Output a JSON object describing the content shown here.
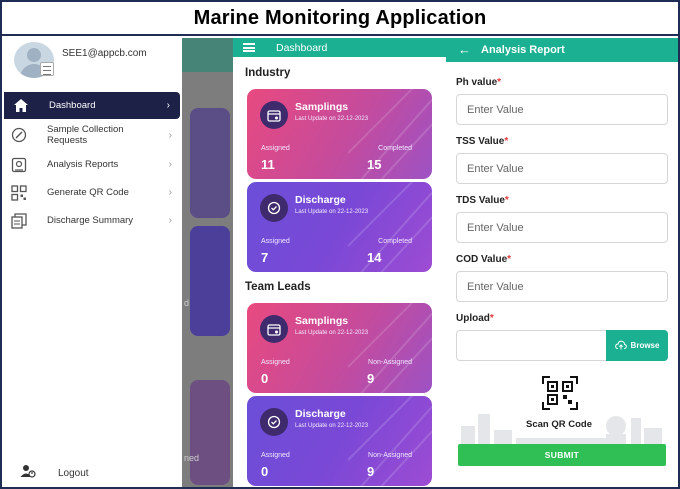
{
  "page_title": "Marine Monitoring Application",
  "drawer": {
    "email": "SEE1@appcb.com",
    "menu": [
      {
        "label": "Dashboard",
        "icon": "home-icon"
      },
      {
        "label": "Sample Collection Requests",
        "icon": "clipboard-link-icon"
      },
      {
        "label": "Analysis Reports",
        "icon": "report-icon"
      },
      {
        "label": "Generate QR Code",
        "icon": "qr-grid-icon"
      },
      {
        "label": "Discharge Summary",
        "icon": "documents-icon"
      }
    ],
    "logout_label": "Logout",
    "background_fragments": {
      "bottom_text": "ned",
      "mid_text": "d"
    }
  },
  "dashboard": {
    "header_title": "Dashboard",
    "industry": {
      "title": "Industry",
      "cards": [
        {
          "title": "Samplings",
          "sub": "Last Update on 22-12-2023",
          "left_label": "Assigned",
          "right_label": "Completed",
          "left_value": "11",
          "right_value": "15"
        },
        {
          "title": "Discharge",
          "sub": "Last Update on 22-12-2023",
          "left_label": "Assigned",
          "right_label": "Completed",
          "left_value": "7",
          "right_value": "14"
        }
      ]
    },
    "team_leads": {
      "title": "Team Leads",
      "cards": [
        {
          "title": "Samplings",
          "sub": "Last Update on 22-12-2023",
          "left_label": "Assigned",
          "right_label": "Non-Assigned",
          "left_value": "0",
          "right_value": "9"
        },
        {
          "title": "Discharge",
          "sub": "Last Update on 22-12-2023",
          "left_label": "Assigned",
          "right_label": "Non-Assigned",
          "left_value": "0",
          "right_value": "9"
        }
      ]
    }
  },
  "report": {
    "header_title": "Analysis Report",
    "fields": [
      {
        "label": "Ph value",
        "required": "*",
        "placeholder": "Enter Value"
      },
      {
        "label": "TSS Value",
        "required": "*",
        "placeholder": "Enter Value"
      },
      {
        "label": "TDS Value",
        "required": "*",
        "placeholder": "Enter Value"
      },
      {
        "label": "COD Value",
        "required": "*",
        "placeholder": "Enter Value"
      }
    ],
    "upload_label": "Upload",
    "upload_required": "*",
    "browse_label": "Browse",
    "scan_label": "Scan QR Code",
    "submit_label": "SUBMIT"
  },
  "colors": {
    "header_green": "#1bb092",
    "drawer_active": "#1d2147",
    "submit_green": "#2fbf55",
    "required_red": "#e23a3a"
  }
}
